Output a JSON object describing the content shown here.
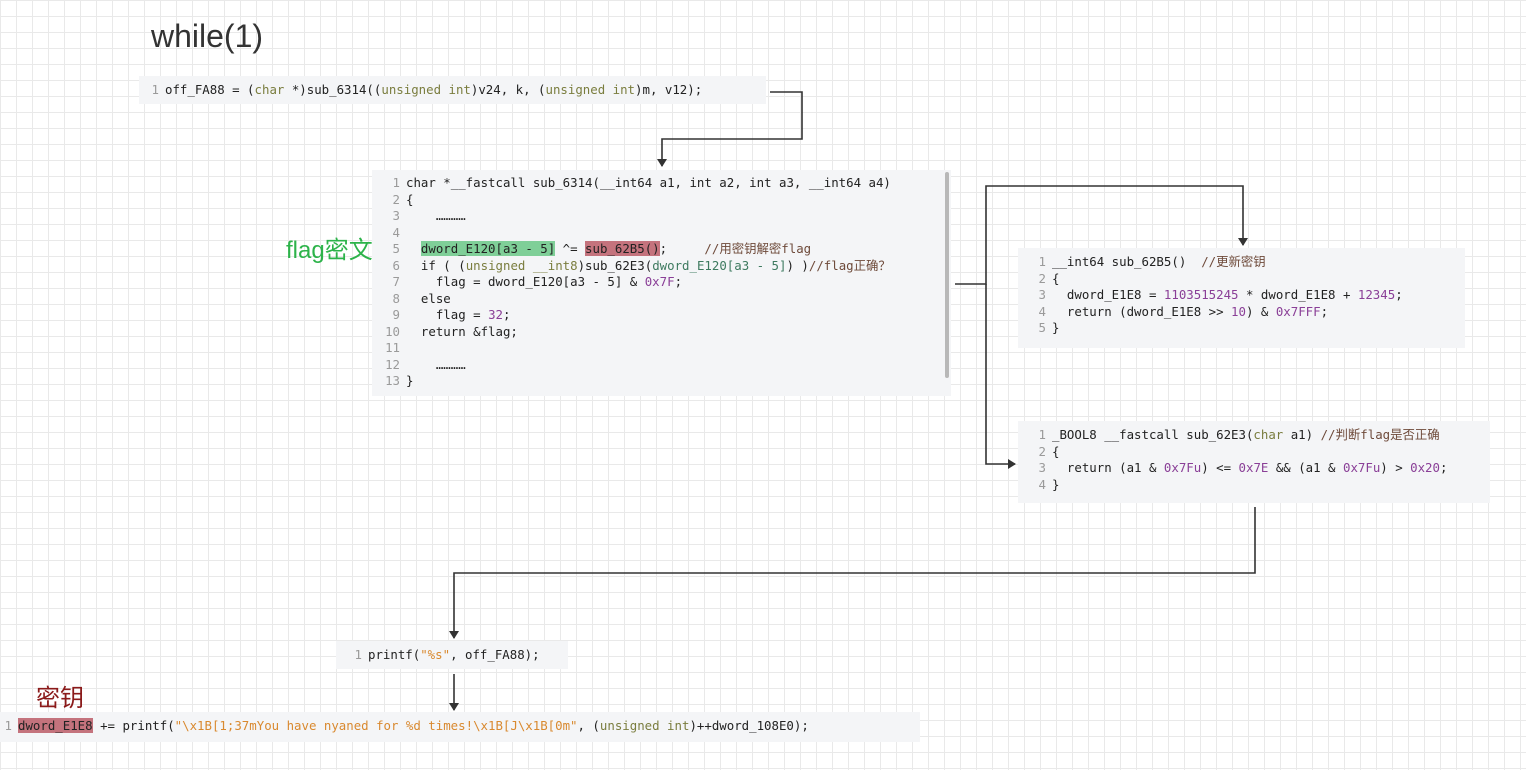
{
  "title": "while(1)",
  "labels": {
    "flag_cipher": "flag密文",
    "key": "密钥"
  },
  "colors": {
    "green_label": "#2db34a",
    "key_label": "#8b1a1a",
    "highlight_green": "#7fcf98",
    "highlight_red": "#c4737d"
  },
  "blocks": {
    "top_call": {
      "lines": [
        {
          "n": "1",
          "segs": [
            [
              "off_FA88 = (",
              ""
            ],
            [
              "char",
              "kw"
            ],
            [
              " *)sub_6314((",
              ""
            ],
            [
              "unsigned int",
              "kw"
            ],
            [
              ")v24, k, (",
              ""
            ],
            [
              "unsigned int",
              "kw"
            ],
            [
              ")m, v12);",
              ""
            ]
          ]
        }
      ]
    },
    "sub_6314": {
      "lines": [
        {
          "n": "1",
          "segs": [
            [
              "char *__fastcall sub_6314(__int64 a1, int a2, int a3, __int64 a4)",
              ""
            ]
          ]
        },
        {
          "n": "2",
          "segs": [
            [
              "{",
              ""
            ]
          ]
        },
        {
          "n": "3",
          "segs": [
            [
              "    …………",
              ""
            ]
          ]
        },
        {
          "n": "4",
          "segs": [
            [
              "",
              ""
            ]
          ]
        },
        {
          "n": "5",
          "segs": [
            [
              "  ",
              ""
            ],
            [
              "dword_E120[a3 - 5]",
              "hl-green"
            ],
            [
              " ^= ",
              ""
            ],
            [
              "sub_62B5()",
              "hl-red"
            ],
            [
              ";     ",
              ""
            ],
            [
              "//用密钥解密flag",
              "cm"
            ]
          ]
        },
        {
          "n": "6",
          "segs": [
            [
              "  if ( (",
              ""
            ],
            [
              "unsigned __int8",
              "kw"
            ],
            [
              ")sub_62E3(",
              ""
            ],
            [
              "dword_E120[a3 - 5]",
              "id"
            ],
            [
              ") )",
              ""
            ],
            [
              "//flag正确？",
              "cm"
            ]
          ]
        },
        {
          "n": "7",
          "segs": [
            [
              "    flag = dword_E120[a3 - 5] & ",
              ""
            ],
            [
              "0x7F",
              "num"
            ],
            [
              ";",
              ""
            ]
          ]
        },
        {
          "n": "8",
          "segs": [
            [
              "  else",
              ""
            ]
          ]
        },
        {
          "n": "9",
          "segs": [
            [
              "    flag = ",
              ""
            ],
            [
              "32",
              "num"
            ],
            [
              ";",
              ""
            ]
          ]
        },
        {
          "n": "10",
          "segs": [
            [
              "  return &flag;",
              ""
            ]
          ]
        },
        {
          "n": "11",
          "segs": [
            [
              "",
              ""
            ]
          ]
        },
        {
          "n": "12",
          "segs": [
            [
              "    …………",
              ""
            ]
          ]
        },
        {
          "n": "13",
          "segs": [
            [
              "}",
              ""
            ]
          ]
        }
      ]
    },
    "sub_62B5": {
      "lines": [
        {
          "n": "1",
          "segs": [
            [
              "__int64 sub_62B5()  ",
              ""
            ],
            [
              "//更新密钥",
              "cm"
            ]
          ]
        },
        {
          "n": "2",
          "segs": [
            [
              "{",
              ""
            ]
          ]
        },
        {
          "n": "3",
          "segs": [
            [
              "  dword_E1E8 = ",
              ""
            ],
            [
              "1103515245",
              "num"
            ],
            [
              " * dword_E1E8 + ",
              ""
            ],
            [
              "12345",
              "num"
            ],
            [
              ";",
              ""
            ]
          ]
        },
        {
          "n": "4",
          "segs": [
            [
              "  return (dword_E1E8 >> ",
              ""
            ],
            [
              "10",
              "num"
            ],
            [
              ") & ",
              ""
            ],
            [
              "0x7FFF",
              "num"
            ],
            [
              ";",
              ""
            ]
          ]
        },
        {
          "n": "5",
          "segs": [
            [
              "}",
              ""
            ]
          ]
        }
      ]
    },
    "sub_62E3": {
      "lines": [
        {
          "n": "1",
          "segs": [
            [
              "_BOOL8 __fastcall sub_62E3(",
              ""
            ],
            [
              "char",
              "kw"
            ],
            [
              " a1) ",
              ""
            ],
            [
              "//判断flag是否正确",
              "cm"
            ]
          ]
        },
        {
          "n": "2",
          "segs": [
            [
              "{",
              ""
            ]
          ]
        },
        {
          "n": "3",
          "segs": [
            [
              "  return (a1 & ",
              ""
            ],
            [
              "0x7Fu",
              "num"
            ],
            [
              ") <= ",
              ""
            ],
            [
              "0x7E",
              "num"
            ],
            [
              " && (a1 & ",
              ""
            ],
            [
              "0x7Fu",
              "num"
            ],
            [
              ") > ",
              ""
            ],
            [
              "0x20",
              "num"
            ],
            [
              ";",
              ""
            ]
          ]
        },
        {
          "n": "4",
          "segs": [
            [
              "}",
              ""
            ]
          ]
        }
      ]
    },
    "printf_call": {
      "lines": [
        {
          "n": "1",
          "segs": [
            [
              "printf(",
              ""
            ],
            [
              "\"%s\"",
              "str"
            ],
            [
              ", off_FA88);",
              ""
            ]
          ]
        }
      ]
    },
    "key_update": {
      "lines": [
        {
          "n": "1",
          "segs": [
            [
              "dword_E1E8",
              "hl-red"
            ],
            [
              " += printf(",
              ""
            ],
            [
              "\"\\x1B[1;37mYou have nyaned for %d times!\\x1B[J\\x1B[0m\"",
              "str"
            ],
            [
              ", (",
              ""
            ],
            [
              "unsigned int",
              "kw"
            ],
            [
              ")++dword_108E0);",
              ""
            ]
          ]
        }
      ]
    }
  }
}
